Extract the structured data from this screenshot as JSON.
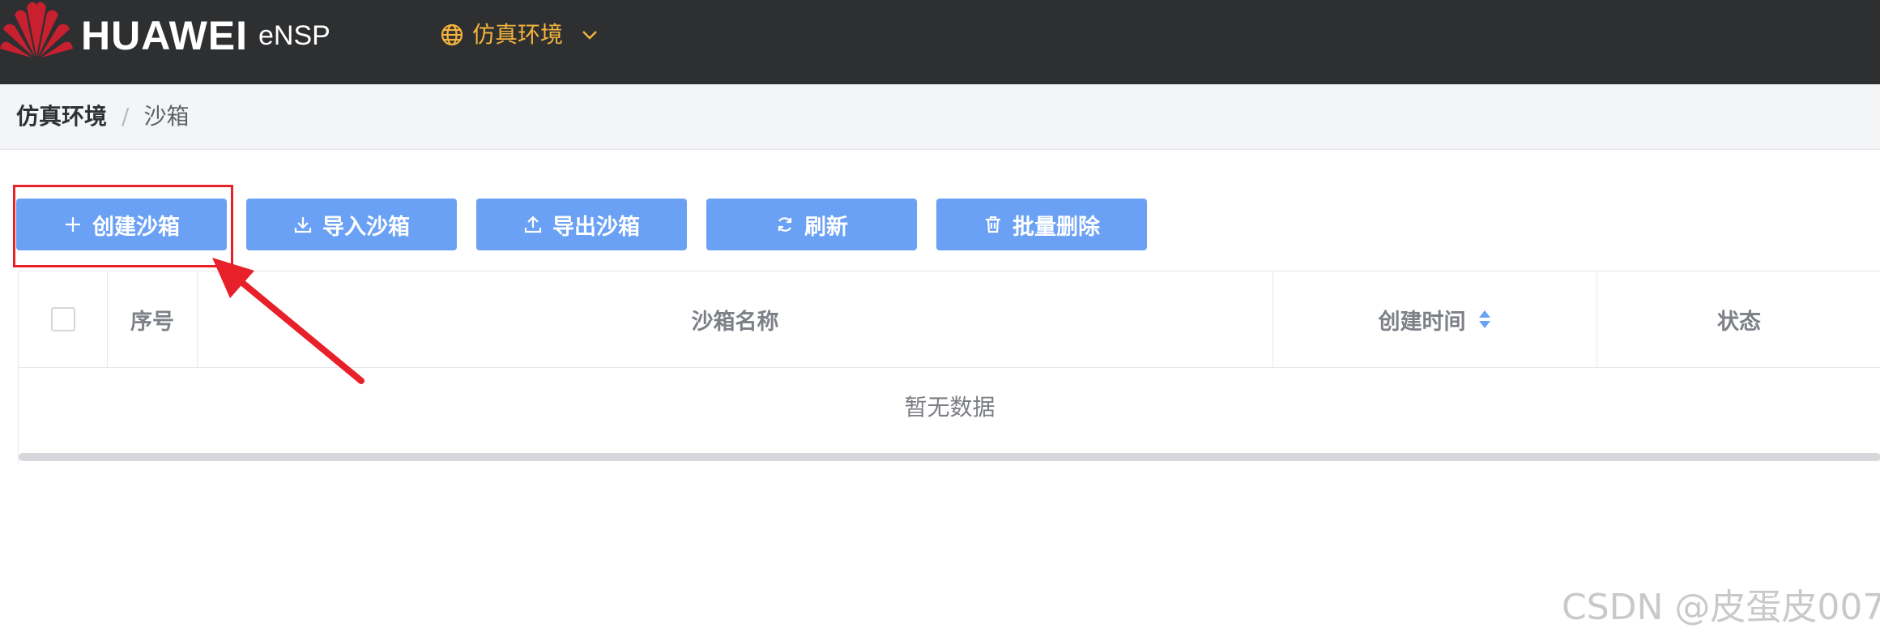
{
  "header": {
    "brand": "HUAWEI",
    "product": "eNSP",
    "env_switch": {
      "label": "仿真环境",
      "icon": "globe-icon"
    }
  },
  "breadcrumb": {
    "root": "仿真环境",
    "separator": "/",
    "current": "沙箱"
  },
  "toolbar": [
    {
      "label": "创建沙箱",
      "icon": "plus-icon"
    },
    {
      "label": "导入沙箱",
      "icon": "download-icon"
    },
    {
      "label": "导出沙箱",
      "icon": "upload-icon"
    },
    {
      "label": "刷新",
      "icon": "refresh-icon"
    },
    {
      "label": "批量删除",
      "icon": "trash-icon"
    }
  ],
  "table": {
    "columns": [
      "序号",
      "沙箱名称",
      "创建时间",
      "状态"
    ],
    "rows": [],
    "empty_text": "暂无数据"
  },
  "watermark": "CSDN @皮蛋皮007",
  "colors": {
    "topbar_bg": "#2e2f31",
    "accent_orange": "#f3b33d",
    "button_blue": "#6aa1f5",
    "annotation_red": "#e8202a"
  }
}
